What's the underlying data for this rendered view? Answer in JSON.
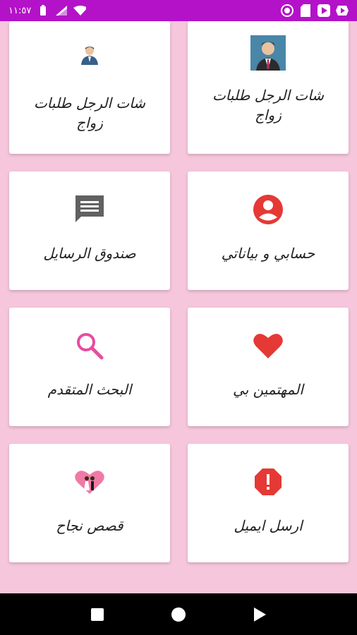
{
  "status_bar": {
    "time": "١١:٥٧",
    "left_icons": [
      "battery-icon",
      "signal-icon",
      "wifi-icon"
    ],
    "right_icons": [
      "record-icon",
      "sd-card-icon",
      "play-store-icon",
      "youtube-icon"
    ],
    "color": "#b412c9"
  },
  "cards": [
    {
      "label_line1": "شات الرجل طلبات",
      "label_line2": "زواج",
      "icon": "man-avatar-photo-icon"
    },
    {
      "label_line1": "شات الرجل طلبات",
      "label_line2": "زواج",
      "icon": "man-avatar-small-icon"
    },
    {
      "label_line1": "حسابي و بياناتي",
      "label_line2": "",
      "icon": "account-circle-icon"
    },
    {
      "label_line1": "صندوق الرسايل",
      "label_line2": "",
      "icon": "message-icon"
    },
    {
      "label_line1": "المهتمين بي",
      "label_line2": "",
      "icon": "heart-icon"
    },
    {
      "label_line1": "البحث المتقدم",
      "label_line2": "",
      "icon": "search-icon"
    },
    {
      "label_line1": "ارسل ايميل",
      "label_line2": "",
      "icon": "alert-octagon-icon"
    },
    {
      "label_line1": "قصص نجاح",
      "label_line2": "",
      "icon": "couple-heart-icon"
    }
  ],
  "colors": {
    "background": "#f6c6dc",
    "red": "#e53935",
    "pink": "#e64da0",
    "gray": "#616161"
  },
  "nav_bar": {
    "icons": [
      "recent-apps-icon",
      "home-icon",
      "back-icon"
    ]
  }
}
